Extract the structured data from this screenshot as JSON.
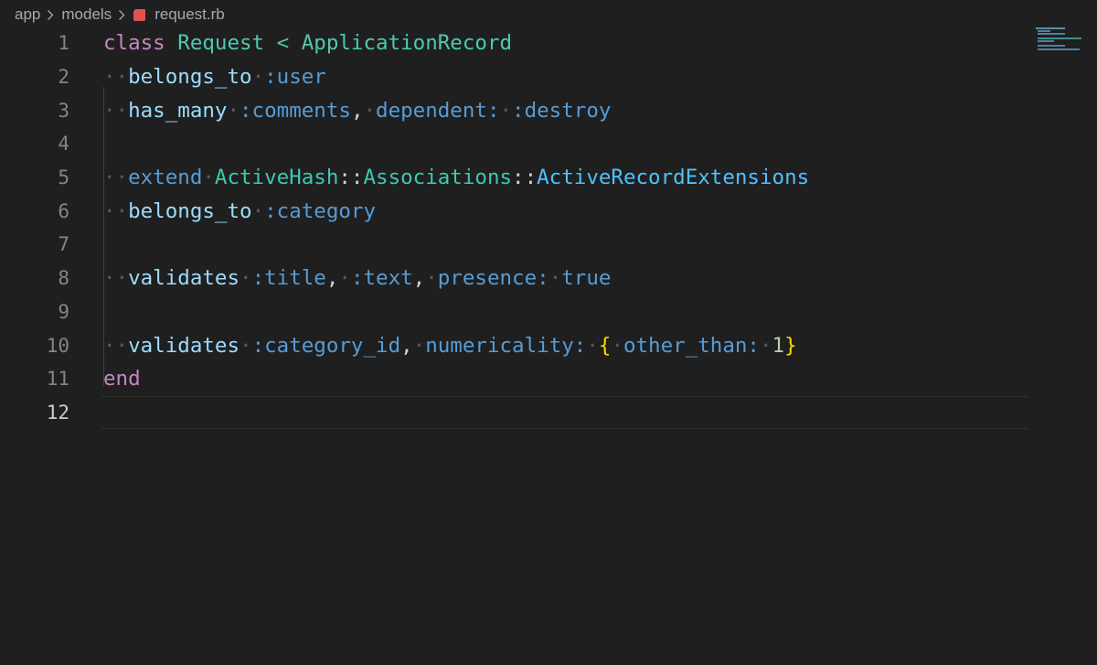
{
  "breadcrumb": {
    "items": [
      "app",
      "models"
    ],
    "file": "request.rb"
  },
  "colors": {
    "background": "#1f1f1f",
    "keyword": "#c586c0",
    "class_name": "#4ec9b0",
    "method": "#9cdcfe",
    "symbol": "#569cd6",
    "number": "#b5cea8",
    "ruby_icon": "#e05252"
  },
  "editor": {
    "language": "ruby",
    "line_numbers": [
      "1",
      "2",
      "3",
      "4",
      "5",
      "6",
      "7",
      "8",
      "9",
      "10",
      "11",
      "12"
    ],
    "lines": [
      "class Request < ApplicationRecord",
      "  belongs_to :user",
      "  has_many :comments, dependent: :destroy",
      "",
      "  extend ActiveHash::Associations::ActiveRecordExtensions",
      "  belongs_to :category",
      "",
      "  validates :title, :text, presence: true",
      "",
      "  validates :category_id, numericality: { other_than: 1}",
      "end",
      ""
    ],
    "tokens": {
      "l1": {
        "kw": "class",
        "cls": "Request",
        "op": "<",
        "parent": "ApplicationRecord"
      },
      "l2": {
        "fn": "belongs_to",
        "sym": ":user"
      },
      "l3": {
        "fn": "has_many",
        "sym": ":comments",
        "comma": ",",
        "key": "dependent:",
        "sym2": ":destroy"
      },
      "l5": {
        "kw": "extend",
        "mod1": "ActiveHash",
        "sep1": "::",
        "mod2": "Associations",
        "sep2": "::",
        "const": "ActiveRecordExtensions"
      },
      "l6": {
        "fn": "belongs_to",
        "sym": ":category"
      },
      "l8": {
        "fn": "validates",
        "sym1": ":title",
        "comma1": ",",
        "sym2": ":text",
        "comma2": ",",
        "key": "presence:",
        "val": "true"
      },
      "l10": {
        "fn": "validates",
        "sym": ":category_id",
        "comma": ",",
        "key": "numericality:",
        "ob": "{",
        "key2": "other_than:",
        "num": "1",
        "cb": "}"
      },
      "l11": {
        "kw": "end"
      }
    },
    "active_line": "12"
  }
}
